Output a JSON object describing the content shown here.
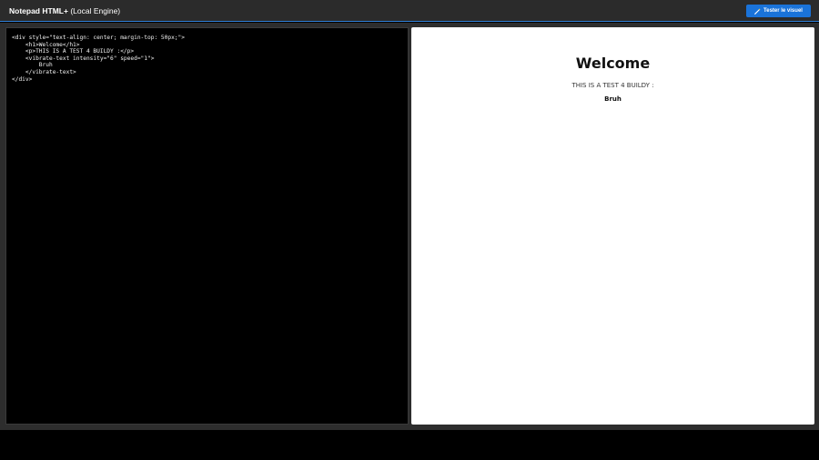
{
  "header": {
    "app_name": "Notepad HTML+",
    "engine_label": "(Local Engine)",
    "test_button_label": "Tester le visuel",
    "test_button_icon": "magic-wand-icon",
    "accent_color": "#1a73d9"
  },
  "editor": {
    "code": "<div style=\"text-align: center; margin-top: 50px;\">\n    <h1>Welcome</h1>\n    <p>THIS IS A TEST 4 BUILDY :</p>\n    <vibrate-text intensity=\"6\" speed=\"1\">\n        Bruh\n    </vibrate-text>\n</div>"
  },
  "preview": {
    "heading": "Welcome",
    "paragraph": "THIS IS A TEST 4 BUILDY :",
    "vibrate_text": "Bruh"
  }
}
